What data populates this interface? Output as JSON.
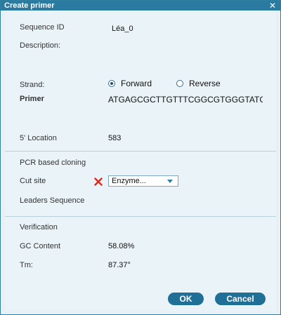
{
  "window": {
    "title": "Create primer",
    "close_glyph": "✕"
  },
  "fields": {
    "sequence_id_label": "Sequence ID",
    "sequence_id_value": "Léa_0",
    "description_label": "Description:",
    "strand_label": "Strand:",
    "strand_forward": "Forward",
    "strand_reverse": "Reverse",
    "strand_selected": "Forward",
    "primer_label": "Primer",
    "primer_value": "ATGAGCGCTTGTTTCGGCGTGGGTATG",
    "location_label": "5' Location",
    "location_value": "583"
  },
  "pcr": {
    "section_title": "PCR based cloning",
    "cut_site_label": "Cut site",
    "enzyme_value": "Enzyme...",
    "leaders_label": "Leaders Sequence"
  },
  "verification": {
    "section_title": "Verification",
    "gc_label": "GC Content",
    "gc_value": "58.08%",
    "tm_label": "Tm:",
    "tm_value": "87.37°"
  },
  "buttons": {
    "ok": "OK",
    "cancel": "Cancel"
  },
  "colors": {
    "title_bar": "#2a7aa1",
    "button": "#1f6f96",
    "error_x": "#e0281e"
  }
}
